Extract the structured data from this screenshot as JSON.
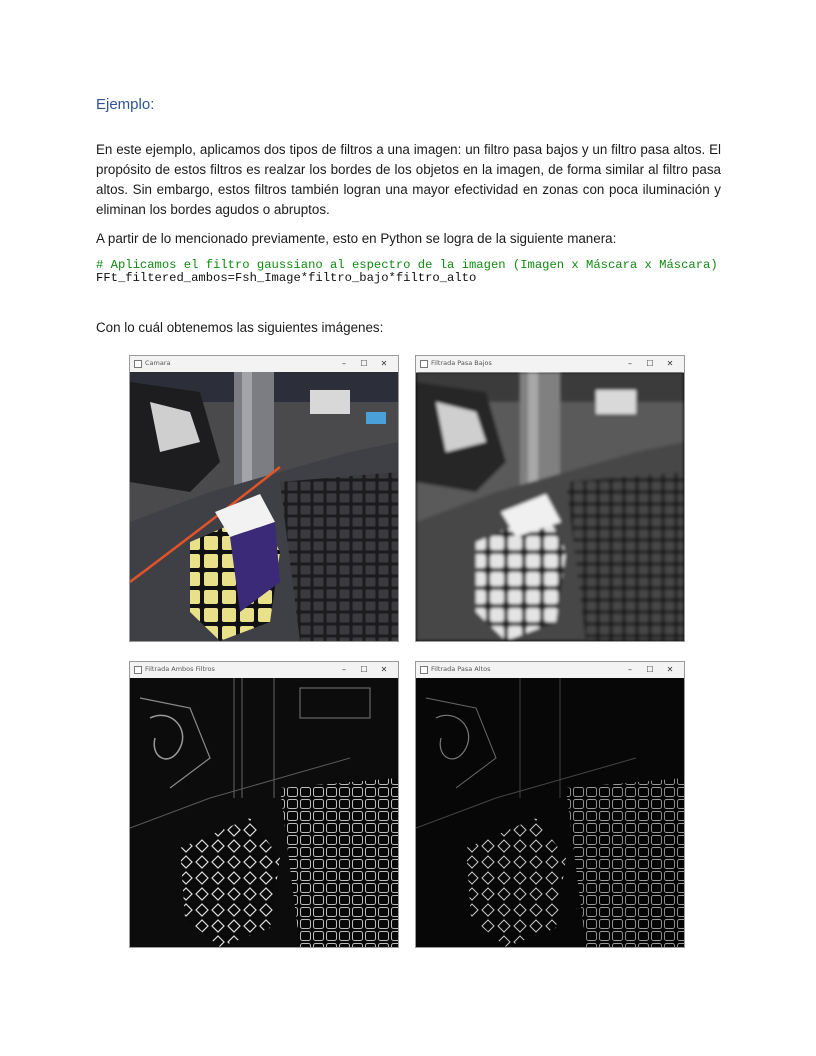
{
  "heading": "Ejemplo:",
  "paragraph1": "En este ejemplo, aplicamos dos tipos de filtros a una imagen: un filtro pasa bajos y un filtro pasa altos. El propósito de estos filtros es realzar los bordes de los objetos en la imagen, de forma similar al filtro pasa altos. Sin embargo, estos filtros también logran una mayor efectividad en zonas con poca iluminación y eliminan los bordes agudos o abruptos.",
  "paragraph2": "A partir de lo mencionado previamente, esto en Python se logra de la siguiente manera:",
  "code": {
    "comment": "# Aplicamos el filtro gaussiano al espectro de la imagen (Imagen x Máscara x Máscara)",
    "statement": "FFt_filtered_ambos=Fsh_Image*filtro_bajo*filtro_alto"
  },
  "paragraph3": "Con lo cuál obtenemos las siguientes imágenes:",
  "windows": [
    {
      "title": "Camara"
    },
    {
      "title": "Filtrada Pasa Bajos"
    },
    {
      "title": "Filtrada Ambos Filtros"
    },
    {
      "title": "Filtrada Pasa Altos"
    }
  ],
  "window_controls": {
    "minimize": "–",
    "maximize": "☐",
    "close": "✕"
  }
}
